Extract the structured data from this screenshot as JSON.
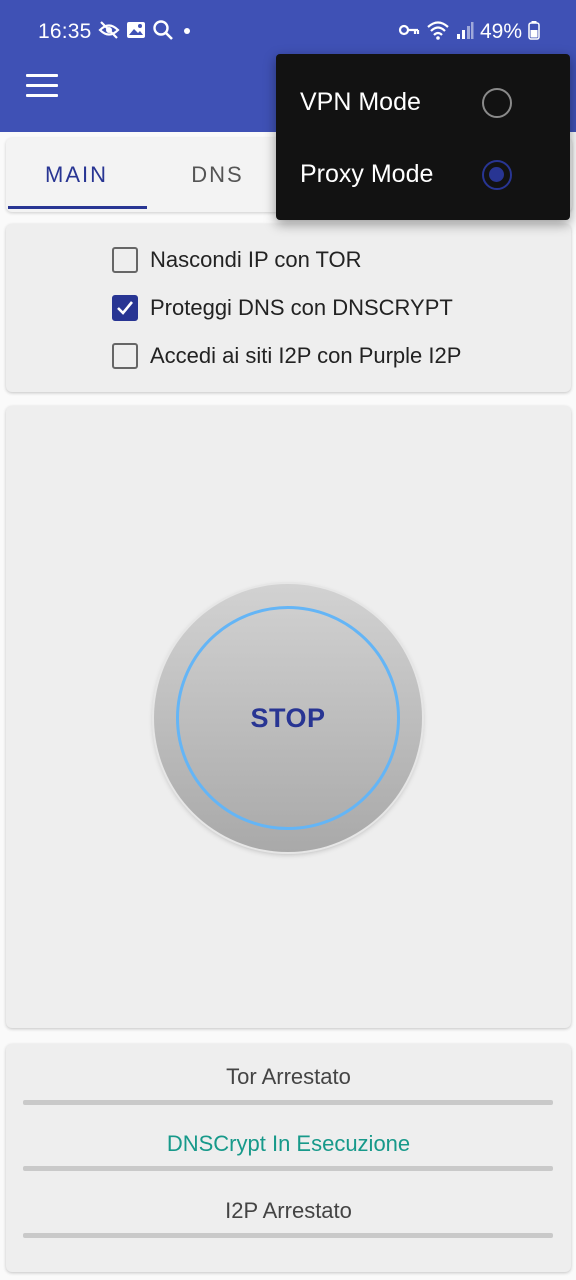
{
  "status_bar": {
    "time": "16:35",
    "battery_pct": "49%",
    "icons": [
      "eye-off-icon",
      "image-icon",
      "search-icon",
      "dot-icon",
      "vpn-key-icon",
      "wifi-icon",
      "signal-icon",
      "battery-icon"
    ]
  },
  "app_bar": {
    "menu_icon": "hamburger-menu-icon",
    "color": "#3f51b5"
  },
  "tabs": [
    {
      "label": "MAIN",
      "active": true
    },
    {
      "label": "DNS",
      "active": false
    }
  ],
  "options": [
    {
      "label": "Nascondi IP con TOR",
      "checked": false
    },
    {
      "label": "Proteggi DNS con DNSCRYPT",
      "checked": true
    },
    {
      "label": "Accedi ai siti I2P con Purple I2P",
      "checked": false
    }
  ],
  "main": {
    "stop_label": "STOP"
  },
  "statuses": [
    {
      "text": "Tor Arrestato",
      "color": "#444444"
    },
    {
      "text": "DNSCrypt In Esecuzione",
      "color": "#17998a"
    },
    {
      "text": "I2P Arrestato",
      "color": "#444444"
    }
  ],
  "mode_menu": {
    "items": [
      {
        "label": "VPN Mode",
        "selected": false
      },
      {
        "label": "Proxy Mode",
        "selected": true
      }
    ]
  },
  "colors": {
    "primary": "#3f51b5",
    "accent": "#283593",
    "ring": "#64b5f6",
    "running": "#17998a"
  }
}
